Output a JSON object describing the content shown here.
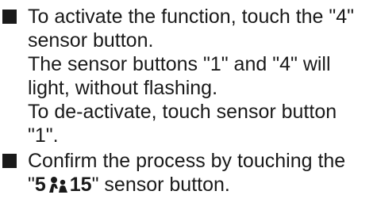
{
  "items": [
    {
      "bullet_icon": "square-bullet-icon",
      "lines": [
        "To activate the function, touch the \"4\"",
        "sensor button.",
        "The sensor buttons \"1\" and \"4\" will",
        "light, without flashing.",
        "To de-activate, touch sensor button",
        "\"1\"."
      ]
    },
    {
      "bullet_icon": "square-bullet-icon",
      "line1": "Confirm the process by touching the",
      "line2_prefix": "\"",
      "line2_bold_left": "5",
      "line2_icon": "child-lock-icon",
      "line2_bold_right": "15",
      "line2_suffix": "\" sensor button."
    }
  ]
}
